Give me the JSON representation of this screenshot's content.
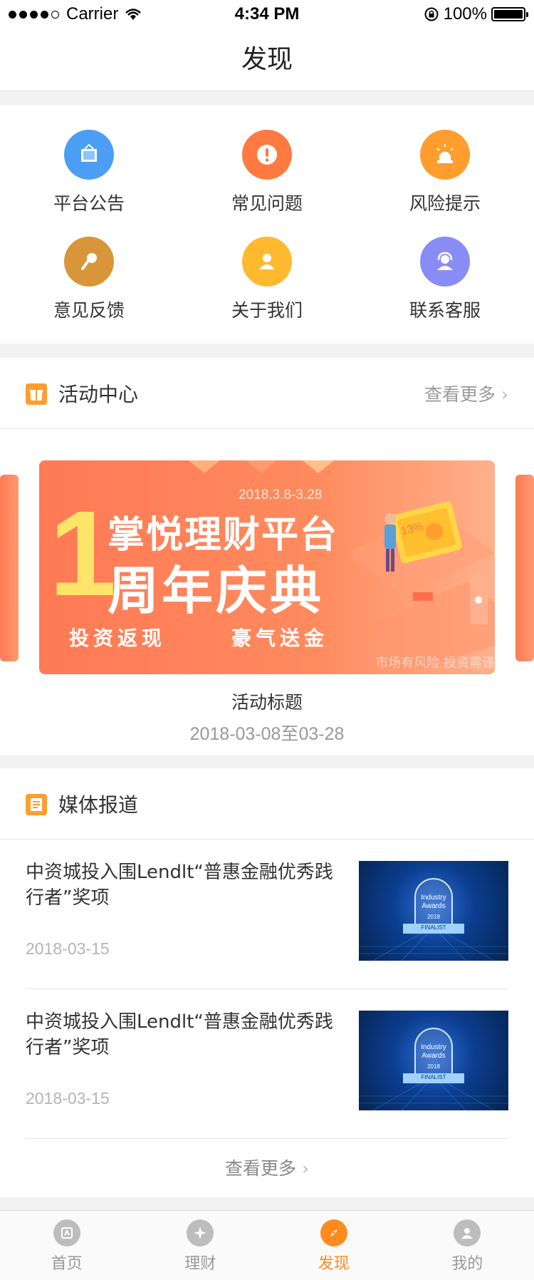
{
  "status_bar": {
    "carrier": "Carrier",
    "time": "4:34 PM",
    "battery": "100%"
  },
  "nav": {
    "title": "发现"
  },
  "grid": [
    {
      "label": "平台公告",
      "icon": "notice-board-icon",
      "color": "#4a9ff5"
    },
    {
      "label": "常见问题",
      "icon": "exclamation-icon",
      "color": "#ff7a40"
    },
    {
      "label": "风险提示",
      "icon": "alarm-light-icon",
      "color": "#ff9d2f"
    },
    {
      "label": "意见反馈",
      "icon": "microphone-icon",
      "color": "#d9953a"
    },
    {
      "label": "关于我们",
      "icon": "person-icon",
      "color": "#ffb92e"
    },
    {
      "label": "联系客服",
      "icon": "headset-icon",
      "color": "#8a8cf5"
    }
  ],
  "activity": {
    "title": "活动中心",
    "more": "查看更多",
    "banner": {
      "date": "2018.3.8-3.28",
      "big_number": "1",
      "line1": "掌悦理财平台",
      "line2": "周年庆典",
      "slogan_left": "投资返现",
      "slogan_right": "豪气送金",
      "risk_note": "市场有风险 投资需谨",
      "sign_text": "13%"
    },
    "item_title": "活动标题",
    "item_date": "2018-03-08至03-28"
  },
  "media": {
    "title": "媒体报道",
    "items": [
      {
        "title": "中资城投入围Lendlt“普惠金融优秀践行者”奖项",
        "date": "2018-03-15",
        "badge": [
          "Industry",
          "Awards",
          "2018",
          "FINALIST"
        ]
      },
      {
        "title": "中资城投入围Lendlt“普惠金融优秀践行者”奖项",
        "date": "2018-03-15",
        "badge": [
          "Industry",
          "Awards",
          "2018",
          "FINALIST"
        ]
      }
    ],
    "more": "查看更多"
  },
  "tabs": [
    {
      "label": "首页",
      "icon": "home-icon",
      "active": false
    },
    {
      "label": "理财",
      "icon": "finance-icon",
      "active": false
    },
    {
      "label": "发现",
      "icon": "compass-icon",
      "active": true
    },
    {
      "label": "我的",
      "icon": "profile-icon",
      "active": false
    }
  ],
  "accent_color": "#ff8a1e"
}
